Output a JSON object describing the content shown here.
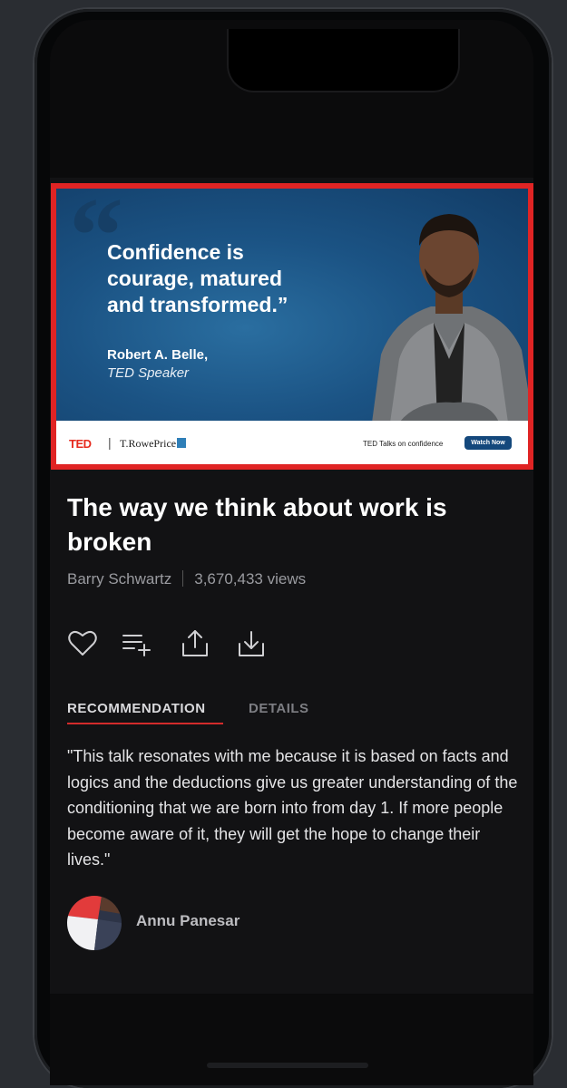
{
  "ad": {
    "quote": "Confidence is\ncourage, matured\nand transformed.”",
    "speaker": "Robert A. Belle,",
    "role": "TED Speaker",
    "ted_logo": "TED",
    "separator": "|",
    "sponsor": "T.RowePrice",
    "tagline": "TED Talks on confidence",
    "cta": "Watch Now"
  },
  "talk": {
    "title": "The way we think about work is broken",
    "speaker": "Barry Schwartz",
    "views": "3,670,433 views"
  },
  "actions": [
    "heart-icon",
    "add-to-playlist-icon",
    "share-icon",
    "download-icon"
  ],
  "tabs": {
    "active": "RECOMMENDATION",
    "inactive": "DETAILS"
  },
  "recommendation": {
    "text": "\"This talk resonates with me because it is based on facts and logics and the deductions give us greater understanding of the conditioning that we are born into from day 1. If more people become aware of it, they will get the hope to change their lives.\"",
    "author": "Annu Panesar"
  },
  "colors": {
    "accent_red": "#d32b2b",
    "ad_border": "#e02424",
    "background": "#121214"
  }
}
